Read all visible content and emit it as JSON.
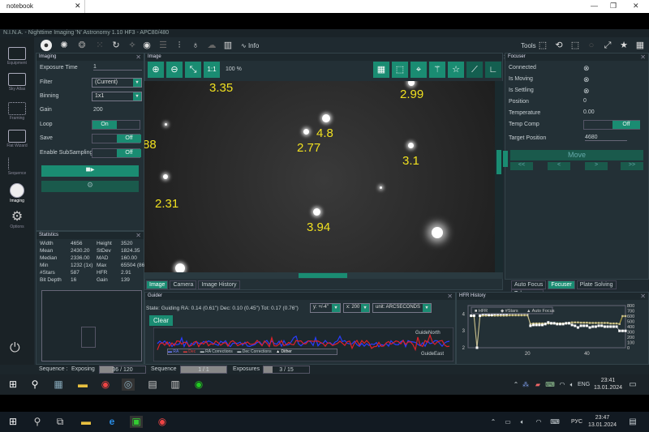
{
  "browser": {
    "tab": "notebook",
    "controls": [
      "—",
      "❐",
      "✕"
    ]
  },
  "app": {
    "title": "N.I.N.A. - Nighttime Imaging 'N' Astronomy 1.10 HF3  -  APC80/480",
    "info": "Info",
    "tools": "Tools"
  },
  "sidebar": [
    {
      "label": "Equipment"
    },
    {
      "label": "Sky Atlas"
    },
    {
      "label": "Framing"
    },
    {
      "label": "Flat Wizard"
    },
    {
      "label": "Sequence"
    },
    {
      "label": "Imaging"
    },
    {
      "label": "Options"
    }
  ],
  "imaging": {
    "title": "Imaging",
    "exposure_label": "Exposure Time",
    "exposure": "1",
    "filter_label": "Filter",
    "filter": "(Current)",
    "binning_label": "Binning",
    "binning": "1x1",
    "gain_label": "Gain",
    "gain": "200",
    "loop_label": "Loop",
    "loop": "On",
    "save_label": "Save",
    "save": "Off",
    "subsampling_label": "Enable SubSampling",
    "subsampling": "Off"
  },
  "statistics": {
    "title": "Statistics",
    "rows": [
      [
        "Width",
        "4656",
        "Height",
        "3520"
      ],
      [
        "Mean",
        "2430.20",
        "StDev",
        "1824.35"
      ],
      [
        "Median",
        "2336.00",
        "MAD",
        "160.00"
      ],
      [
        "Min",
        "1232 (1x)",
        "Max",
        "65504 (86"
      ],
      [
        "#Stars",
        "587",
        "HFR",
        "2.91"
      ],
      [
        "Bit Depth",
        "16",
        "Gain",
        "139"
      ]
    ]
  },
  "image": {
    "title": "Image",
    "zoom": "100 %",
    "one_to_one": "1:1",
    "stars": [
      "3.35",
      "2.99",
      "4.8",
      "2.77",
      "3.1",
      "88",
      "2.31",
      "3.94"
    ],
    "tabs": [
      "Image",
      "Camera",
      "Image History"
    ]
  },
  "focuser": {
    "title": "Focuser",
    "rows": [
      {
        "label": "Connected",
        "value": "⊗"
      },
      {
        "label": "Is Moving",
        "value": "⊗"
      },
      {
        "label": "Is Settling",
        "value": "⊗"
      },
      {
        "label": "Position",
        "value": "0"
      },
      {
        "label": "Temperature",
        "value": "0.00"
      }
    ],
    "temp_comp_label": "Temp Comp",
    "temp_comp": "Off",
    "target_label": "Target Position",
    "target": "4680",
    "move": "Move",
    "steps": [
      "<<",
      "<",
      ">",
      ">>"
    ],
    "tabs": [
      "Auto Focus",
      "Focuser",
      "Plate Solving",
      "Telescope"
    ],
    "active_tab": "Focuser"
  },
  "guider": {
    "title": "Guider",
    "state": "State: Guiding  RA: 0.14 (0.61\")  Dec: 0.10 (0.45\")  Tot: 0.17 (0.76\")",
    "y_scale": "y: +/-4\"",
    "x_scale": "x: 200",
    "unit": "unit: ARCSECONDS",
    "clear": "Clear",
    "north": "GuideNorth",
    "east": "GuideEast",
    "legend": [
      "RA",
      "Dec",
      "RA Corrections",
      "Dec Corrections",
      "Dither"
    ],
    "colors": {
      "ra": "#2a3cff",
      "dec": "#e0202a"
    }
  },
  "hfr": {
    "title": "HFR History",
    "legend": [
      "HFR",
      "#Stars",
      "Auto Focus"
    ],
    "y_ticks": [
      "2",
      "3",
      "4"
    ],
    "y2_ticks": [
      "0",
      "100",
      "200",
      "300",
      "400",
      "500",
      "600",
      "700",
      "800"
    ],
    "x_ticks": [
      "20",
      "40"
    ]
  },
  "chart_data": {
    "type": "line",
    "title": "HFR History",
    "x": [
      1,
      2,
      3,
      4,
      5,
      6,
      7,
      8,
      9,
      10,
      11,
      12,
      13,
      14,
      15,
      16,
      17,
      18,
      19,
      20,
      21,
      22,
      23,
      24,
      25,
      26,
      27,
      28,
      29,
      30,
      31,
      32,
      33,
      34,
      35,
      36,
      37,
      38,
      39,
      40,
      41,
      42,
      43,
      44,
      45,
      46,
      47,
      48,
      49,
      50,
      51,
      52,
      53
    ],
    "series": [
      {
        "name": "HFR",
        "values": [
          3.9,
          3.9,
          2.0,
          3.9,
          4.0,
          4.0,
          3.95,
          3.95,
          4.0,
          4.0,
          4.0,
          4.0,
          4.0,
          4.05,
          4.05,
          4.05,
          4.05,
          4.05,
          4.05,
          4.05,
          3.3,
          3.35,
          3.35,
          3.35,
          3.35,
          3.4,
          3.5,
          3.45,
          3.45,
          3.4,
          3.4,
          3.4,
          3.45,
          3.45,
          3.35,
          3.3,
          3.2,
          3.3,
          3.3,
          3.3,
          3.2,
          3.25,
          3.25,
          3.3,
          3.3,
          3.25,
          3.25,
          3.25,
          3.25,
          3.25,
          3.0,
          3.0,
          3.0
        ]
      },
      {
        "name": "#Stars",
        "values": [
          600,
          600,
          0,
          600,
          610,
          610,
          610,
          610,
          610,
          610,
          610,
          610,
          610,
          615,
          615,
          615,
          615,
          615,
          615,
          615,
          450,
          460,
          460,
          460,
          460,
          460,
          460,
          460,
          460,
          460,
          460,
          460,
          460,
          470,
          480,
          480,
          480,
          475,
          475,
          475,
          470,
          470,
          470,
          470,
          470,
          470,
          470,
          460,
          460,
          460,
          450,
          600,
          600
        ]
      }
    ],
    "xlim": [
      0,
      53
    ],
    "ylim": [
      2,
      4.5
    ],
    "y2lim": [
      0,
      800
    ]
  },
  "statusbar": {
    "sequence": "Sequence :",
    "exposing": "Exposing",
    "exposing_value": "36 / 120",
    "exposing_progress": 0.3,
    "seq_label": "Sequence",
    "seq_value": "1 / 1",
    "seq_progress": 1,
    "exposures_label": "Exposures",
    "exposures_value": "3 / 15",
    "exposures_progress": 0.2
  },
  "taskbar_inner": {
    "lang": "ENG",
    "time": "23:41",
    "date": "13.01.2024"
  },
  "taskbar_outer": {
    "lang": "РУС",
    "time": "23:47",
    "date": "13.01.2024"
  }
}
